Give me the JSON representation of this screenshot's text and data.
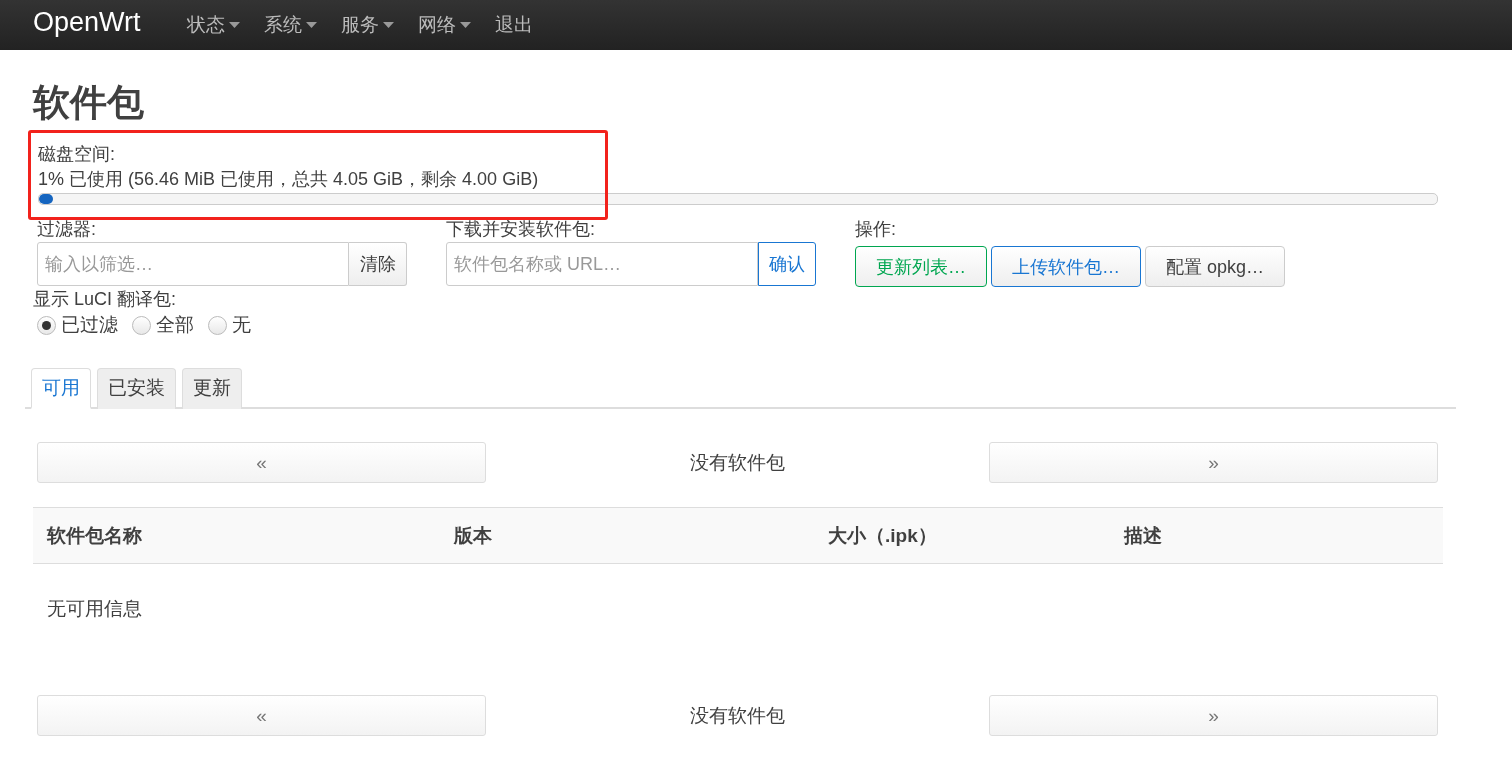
{
  "navbar": {
    "brand": "OpenWrt",
    "menu": [
      {
        "label": "状态",
        "dropdown": true
      },
      {
        "label": "系统",
        "dropdown": true
      },
      {
        "label": "服务",
        "dropdown": true
      },
      {
        "label": "网络",
        "dropdown": true
      },
      {
        "label": "退出",
        "dropdown": false
      }
    ]
  },
  "page_title": "软件包",
  "disk": {
    "label": "磁盘空间:",
    "usage": "1% 已使用 (56.46 MiB 已使用，总共 4.05 GiB，剩余 4.00 GiB)",
    "level": 0.01
  },
  "filter": {
    "label": "过滤器:",
    "placeholder": "输入以筛选…",
    "button": "清除"
  },
  "download": {
    "label": "下载并安装软件包:",
    "placeholder": "软件包名称或 URL…",
    "button": "确认"
  },
  "actions": {
    "label": "操作:",
    "buttons": [
      {
        "label": "更新列表…",
        "kind": "positive"
      },
      {
        "label": "上传软件包…",
        "kind": "primary"
      },
      {
        "label": "配置 opkg…",
        "kind": "default"
      }
    ]
  },
  "translations": {
    "label": "显示 LuCI 翻译包:",
    "options": [
      {
        "label": "已过滤",
        "selected": true
      },
      {
        "label": "全部",
        "selected": false
      },
      {
        "label": "无",
        "selected": false
      }
    ]
  },
  "tabs": [
    {
      "label": "可用",
      "selected": true
    },
    {
      "label": "已安装",
      "selected": false
    },
    {
      "label": "更新",
      "selected": false
    }
  ],
  "pager_top": {
    "prev": "«",
    "status": "没有软件包",
    "next": "»"
  },
  "table": {
    "columns": [
      "软件包名称",
      "版本",
      "大小（.ipk）",
      "描述"
    ],
    "empty_message": "无可用信息"
  },
  "pager_bottom": {
    "prev": "«",
    "status": "没有软件包",
    "next": "»"
  }
}
